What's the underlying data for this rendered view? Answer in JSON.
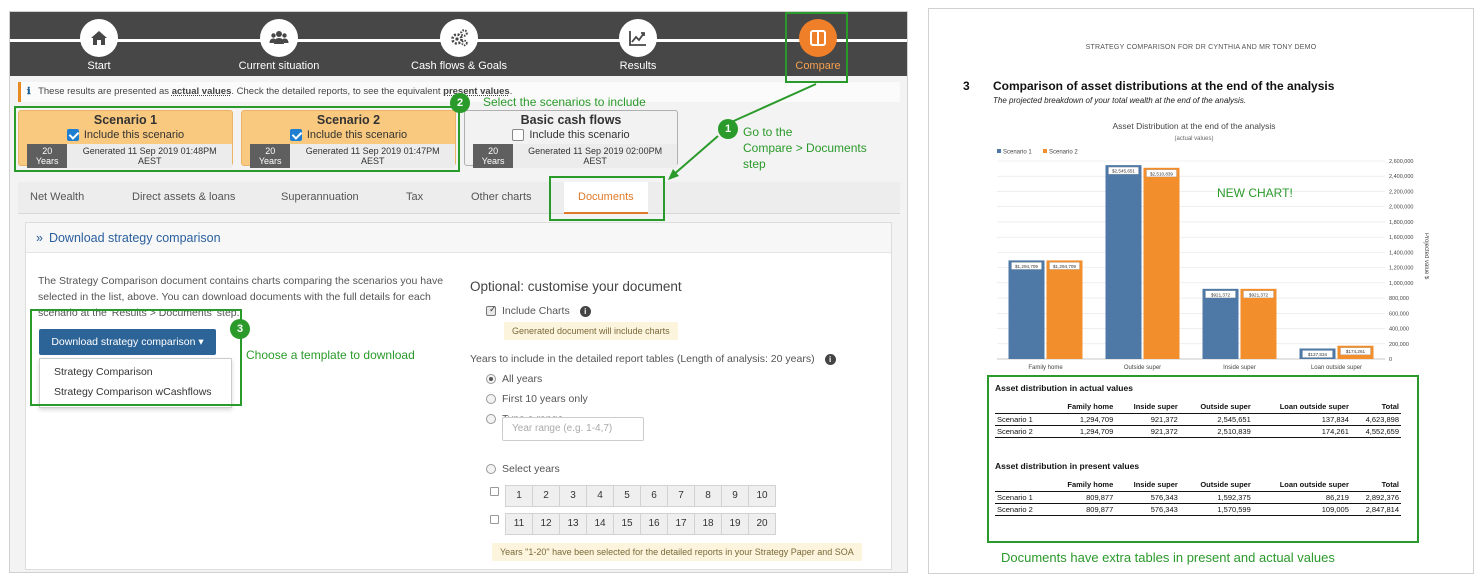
{
  "app": {
    "steps": [
      {
        "label": "Start",
        "icon": "home-icon"
      },
      {
        "label": "Current situation",
        "icon": "people-icon"
      },
      {
        "label": "Cash flows & Goals",
        "icon": "gears-icon"
      },
      {
        "label": "Results",
        "icon": "chart-line-icon"
      },
      {
        "label": "Compare",
        "icon": "columns-icon",
        "active": true
      }
    ],
    "info": {
      "pre": "These results are presented as ",
      "bold1": "actual values",
      "mid": ". Check the detailed reports, to see the equivalent ",
      "bold2": "present values",
      "post": "."
    },
    "scenarios": [
      {
        "title": "Scenario 1",
        "include": "Include this scenario",
        "checked": true,
        "years": "20 Years",
        "generated": "Generated 11 Sep 2019 01:48PM AEST"
      },
      {
        "title": "Scenario 2",
        "include": "Include this scenario",
        "checked": true,
        "years": "20 Years",
        "generated": "Generated 11 Sep 2019 01:47PM AEST"
      },
      {
        "title": "Basic cash flows",
        "include": "Include this scenario",
        "checked": false,
        "years": "20 Years",
        "generated": "Generated 11 Sep 2019 02:00PM AEST"
      }
    ],
    "tabs": [
      "Net Wealth",
      "Direct assets & loans",
      "Superannuation",
      "Tax",
      "Other charts",
      "Documents"
    ],
    "active_tab": "Documents",
    "panel": {
      "header": "Download strategy comparison",
      "description": "The Strategy Comparison document contains charts comparing the scenarios you have selected in the list, above. You can download documents with the full details for each scenario at the 'Results > Documents' step.",
      "download_button": "Download strategy comparison",
      "menu": [
        "Strategy Comparison",
        "Strategy Comparison wCashflows"
      ]
    },
    "options": {
      "title": "Optional: customise your document",
      "include_charts": "Include Charts",
      "charts_note": "Generated document will include charts",
      "years_label": "Years to include in the detailed report tables (Length of analysis: 20 years)",
      "radio_all": "All years",
      "radio_first10": "First 10 years only",
      "radio_range": "Type a range",
      "range_placeholder": "Year range (e.g. 1-4,7)",
      "radio_select": "Select years",
      "years_row1": [
        "1",
        "2",
        "3",
        "4",
        "5",
        "6",
        "7",
        "8",
        "9",
        "10"
      ],
      "years_row2": [
        "11",
        "12",
        "13",
        "14",
        "15",
        "16",
        "17",
        "18",
        "19",
        "20"
      ],
      "selection_note": "Years \"1-20\" have been selected for the detailed reports in your Strategy Paper and SOA"
    },
    "annotations": {
      "a1_num": "1",
      "a1_text_lines": [
        "Go to the",
        "Compare > Documents",
        "step"
      ],
      "a2_num": "2",
      "a2_text": "Select the scenarios to include",
      "a3_num": "3",
      "a3_text": "Choose a template to download"
    }
  },
  "document": {
    "header": "STRATEGY COMPARISON FOR DR CYNTHIA AND MR TONY DEMO",
    "section_number": "3",
    "section_title": "Comparison of asset distributions at the end of the analysis",
    "section_subtitle": "The projected breakdown of your total wealth at the end of the analysis.",
    "new_chart_label": "NEW CHART!",
    "footer_annotation": "Documents have extra tables in present and actual values",
    "table_actual": {
      "title": "Asset distribution in actual values",
      "headers": [
        "",
        "Family home",
        "Inside super",
        "Outside super",
        "Loan outside super",
        "Total"
      ],
      "rows": [
        [
          "Scenario 1",
          "1,294,709",
          "921,372",
          "2,545,651",
          "137,834",
          "4,623,898"
        ],
        [
          "Scenario 2",
          "1,294,709",
          "921,372",
          "2,510,839",
          "174,261",
          "4,552,659"
        ]
      ]
    },
    "table_present": {
      "title": "Asset distribution in present values",
      "headers": [
        "",
        "Family home",
        "Inside super",
        "Outside super",
        "Loan outside super",
        "Total"
      ],
      "rows": [
        [
          "Scenario 1",
          "809,877",
          "576,343",
          "1,592,375",
          "86,219",
          "2,892,376"
        ],
        [
          "Scenario 2",
          "809,877",
          "576,343",
          "1,570,599",
          "109,005",
          "2,847,814"
        ]
      ]
    }
  },
  "chart_data": {
    "type": "bar",
    "title": "Asset Distribution at the end of the analysis",
    "subtitle": "(actual values)",
    "ylabel": "Projected value $",
    "categories": [
      "Family home",
      "Outside super",
      "Inside super",
      "Loan outside super"
    ],
    "series": [
      {
        "name": "Scenario 1",
        "color": "#4e79a7",
        "values": [
          1294709,
          2545651,
          921372,
          137834
        ],
        "labels": [
          "$1,294,709",
          "$2,545,651",
          "$921,372",
          "$137,834"
        ]
      },
      {
        "name": "Scenario 2",
        "color": "#f28e2b",
        "values": [
          1294709,
          2510839,
          921372,
          174261
        ],
        "labels": [
          "$1,294,709",
          "$2,510,839",
          "$921,372",
          "$174,261"
        ]
      }
    ],
    "ylim": [
      0,
      2600000
    ],
    "yticks": [
      "0",
      "200,000",
      "400,000",
      "600,000",
      "800,000",
      "1,000,000",
      "1,200,000",
      "1,400,000",
      "1,600,000",
      "1,800,000",
      "2,000,000",
      "2,200,000",
      "2,400,000",
      "2,600,000"
    ],
    "legend": "top-left",
    "grid": true
  }
}
